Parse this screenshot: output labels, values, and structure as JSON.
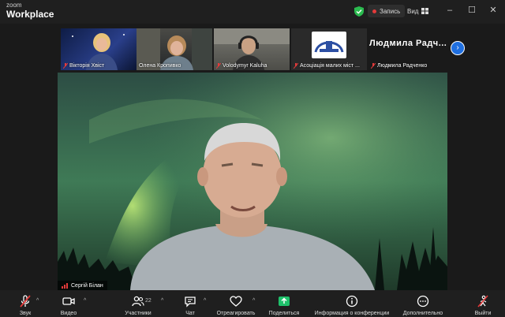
{
  "app": {
    "logo_line1": "zoom",
    "logo_line2": "Workplace"
  },
  "titlebar": {
    "record_label": "Запись",
    "view_label": "Вид",
    "colors": {
      "shield": "#2bbb4f",
      "record_dot": "#e23a3a"
    }
  },
  "participants": [
    {
      "name": "Вікторія Хвіст",
      "muted": true
    },
    {
      "name": "Олена Кропивко",
      "muted": false
    },
    {
      "name": "Volodymyr Kaluha",
      "muted": true
    },
    {
      "name": "Асоціація малих міст ...",
      "muted": true
    },
    {
      "name": "Людмила Радченко",
      "muted": true
    }
  ],
  "featured_name": "Людмила  Радч...",
  "speaker": {
    "name": "Сергій Білан"
  },
  "toolbar": {
    "audio": "Звук",
    "video": "Видео",
    "participants": "Участники",
    "participants_count": "22",
    "chat": "Чат",
    "react": "Отреагировать",
    "share": "Поделиться",
    "info": "Информация о конференции",
    "more": "Дополнительно",
    "leave": "Выйти"
  },
  "colors": {
    "share_green": "#1fc16b",
    "next_button": "#1f6fe0",
    "muted_red": "#e23a3a"
  }
}
